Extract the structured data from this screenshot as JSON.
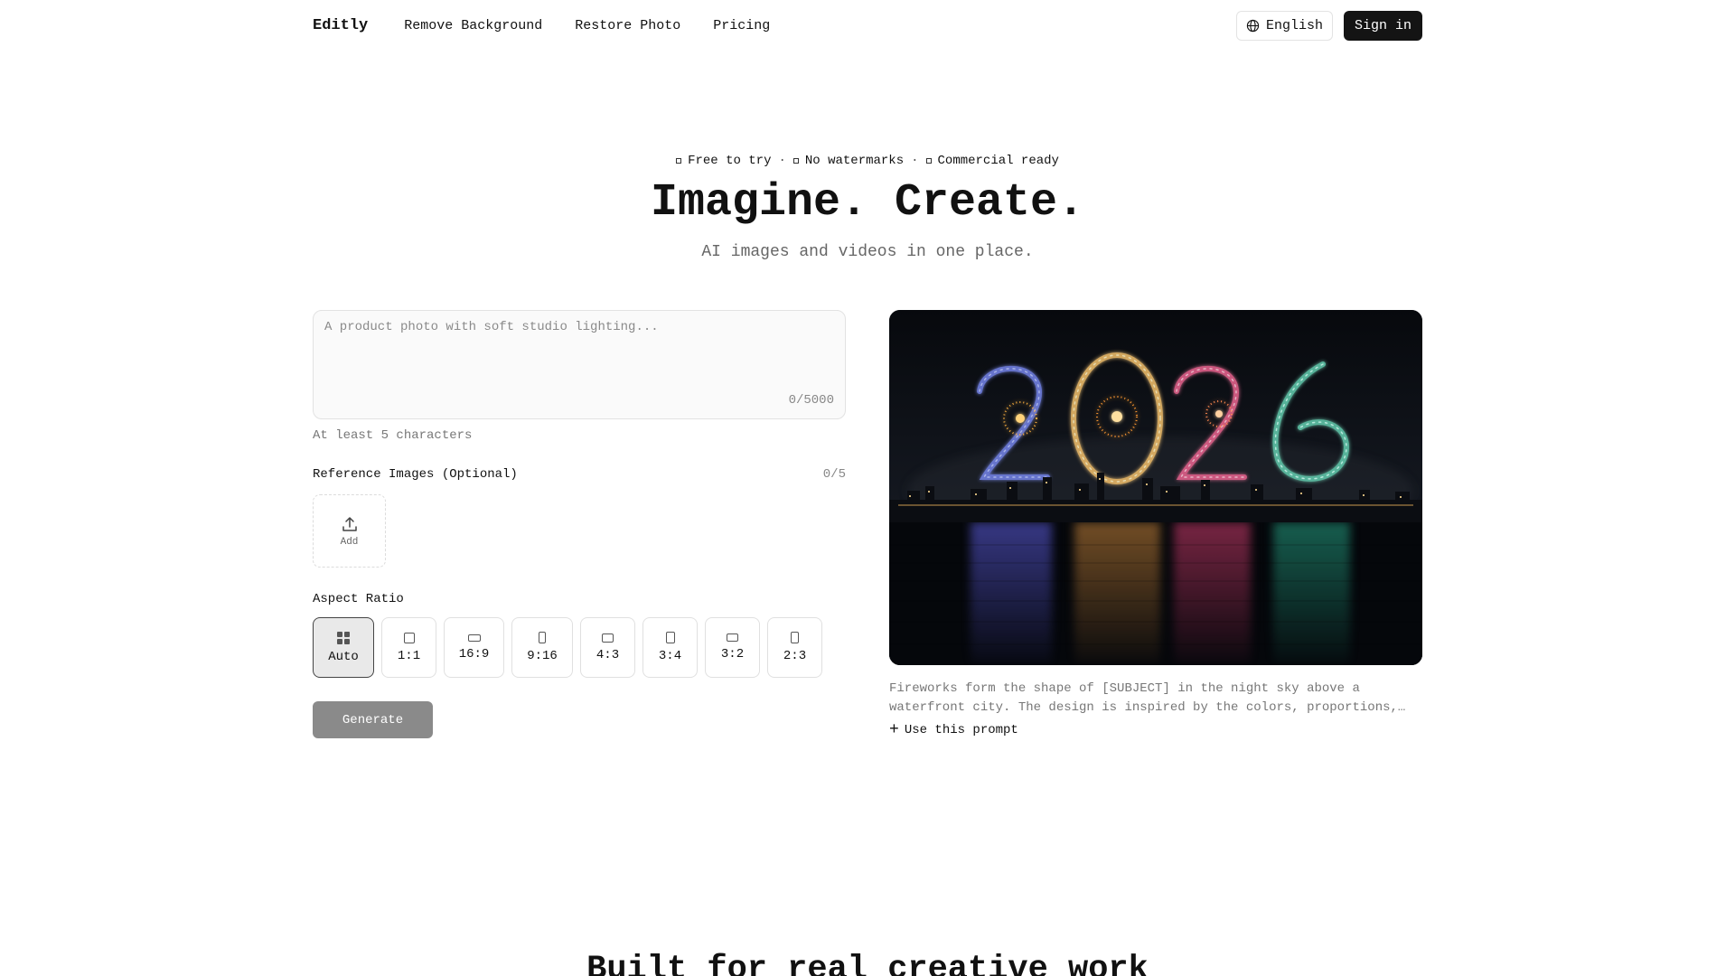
{
  "header": {
    "logo": "Editly",
    "nav": [
      "Remove Background",
      "Restore Photo",
      "Pricing"
    ],
    "language": "English",
    "sign_in": "Sign in"
  },
  "hero": {
    "badges": [
      "Free to try",
      "No watermarks",
      "Commercial ready"
    ],
    "title": "Imagine. Create.",
    "subtitle": "AI images and videos in one place."
  },
  "prompt": {
    "placeholder": "A product photo with soft studio lighting...",
    "value": "",
    "char_count": "0/5000",
    "hint": "At least 5 characters"
  },
  "reference": {
    "label": "Reference Images (Optional)",
    "count": "0/5",
    "add_label": "Add"
  },
  "aspect_ratio": {
    "label": "Aspect Ratio",
    "selected": "Auto",
    "options": [
      "Auto",
      "1:1",
      "16:9",
      "9:16",
      "4:3",
      "3:4",
      "3:2",
      "2:3"
    ]
  },
  "generate_label": "Generate",
  "showcase": {
    "image_text": "2026",
    "caption": "Fireworks form the shape of [SUBJECT] in the night sky above a waterfront city. The design is inspired by the colors, proportions, and style of the subject.",
    "use_prompt": "Use this prompt"
  },
  "section_title": "Built for real creative work",
  "colors": {
    "primary": "#141414",
    "generate_disabled": "#8a8a8a",
    "firework_2a": "#6f7fe0",
    "firework_0": "#e8b868",
    "firework_2b": "#e0608a",
    "firework_6": "#5fc4a8"
  }
}
